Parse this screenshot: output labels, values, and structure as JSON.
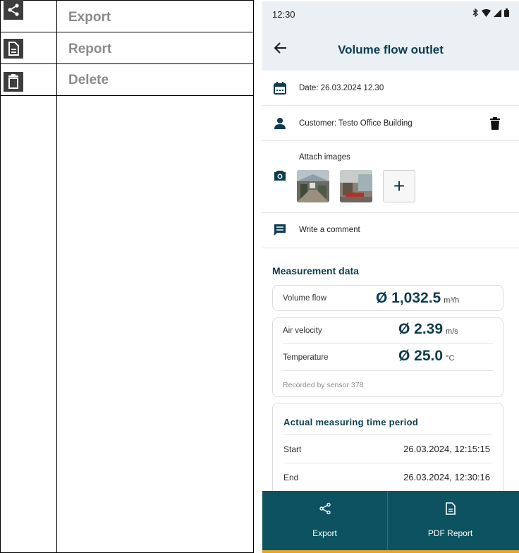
{
  "manual_table": {
    "rows": [
      {
        "icon": "share-icon",
        "label": "Export"
      },
      {
        "icon": "document-icon",
        "label": "Report"
      },
      {
        "icon": "trash-icon",
        "label": "Delete"
      }
    ]
  },
  "phone": {
    "status_time": "12:30",
    "title": "Volume flow outlet",
    "date_text": "Date: 26.03.2024 12.30",
    "customer_text": "Customer: Testo Office Building",
    "attach_label": "Attach images",
    "add_image_symbol": "+",
    "comment_text": "Write a comment",
    "section_title": "Measurement data",
    "volume_flow": {
      "label": "Volume flow",
      "value": "Ø 1,032.5",
      "unit": "m³/h"
    },
    "air_velocity": {
      "label": "Air velocity",
      "value": "Ø 2.39",
      "unit": "m/s"
    },
    "temperature": {
      "label": "Temperature",
      "value": "Ø 25.0",
      "unit": "°C"
    },
    "sensor_note": "Recorded by sensor 378",
    "period": {
      "title": "Actual measuring time period",
      "start_label": "Start",
      "start_value": "26.03.2024, 12:15:15",
      "end_label": "End",
      "end_value": "26.03.2024, 12:30:16"
    },
    "bottom_bar": {
      "export_label": "Export",
      "pdf_label": "PDF Report"
    }
  },
  "colors": {
    "brand_dark": "#0d3d4f",
    "bottom_bar": "#0d5260",
    "accent": "#e3a526",
    "header_bg": "#eaf0f4",
    "table_label": "#8a8a8a"
  }
}
